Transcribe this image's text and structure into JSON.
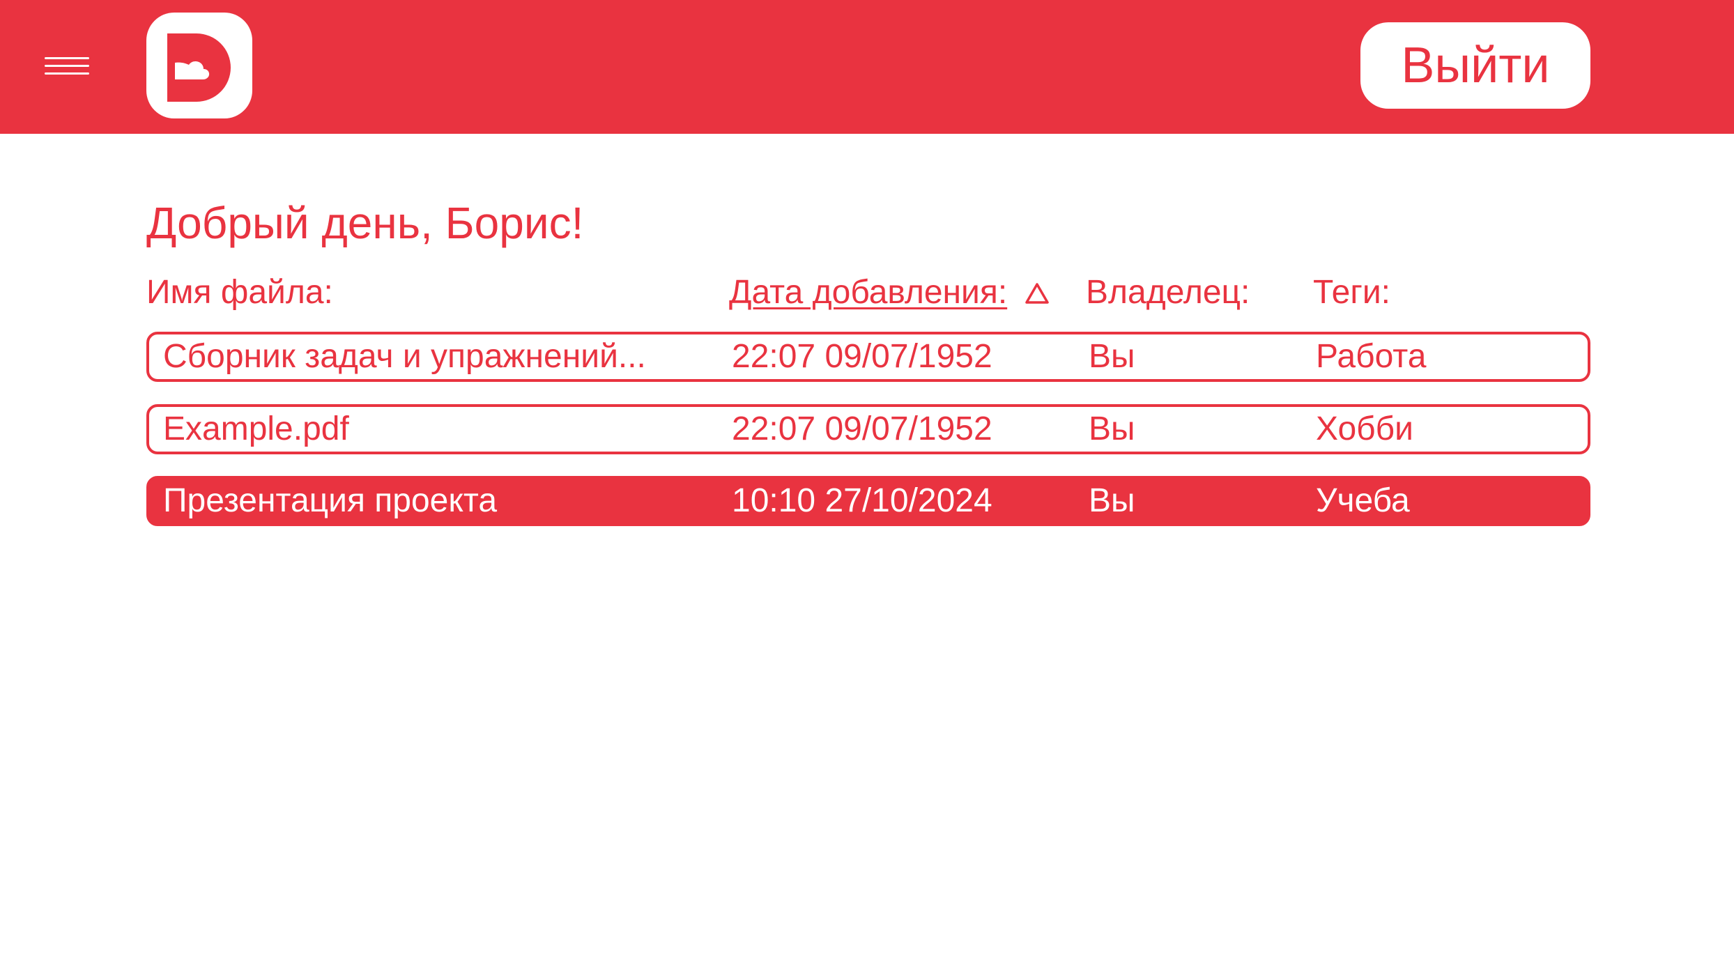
{
  "app": {
    "logout_label": "Выйти",
    "brand_color": "#e93340",
    "menu_icon": "hamburger-menu-icon",
    "logo_icon": "cloud-d-logo-icon"
  },
  "main": {
    "greeting": "Добрый день, Борис!",
    "columns": {
      "name": "Имя файла:",
      "date": "Дата добавления:",
      "owner": "Владелец:",
      "tags": "Теги:"
    },
    "sort": {
      "column": "date",
      "icon": "sort-triangle-icon"
    },
    "files": [
      {
        "name": "Сборник задач и упражнений...",
        "date": "22:07 09/07/1952",
        "owner": "Вы",
        "tag": "Работа",
        "selected": false
      },
      {
        "name": "Example.pdf",
        "date": "22:07 09/07/1952",
        "owner": "Вы",
        "tag": "Хобби",
        "selected": false
      },
      {
        "name": "Презентация проекта",
        "date": "10:10 27/10/2024",
        "owner": "Вы",
        "tag": "Учеба",
        "selected": true
      }
    ]
  }
}
